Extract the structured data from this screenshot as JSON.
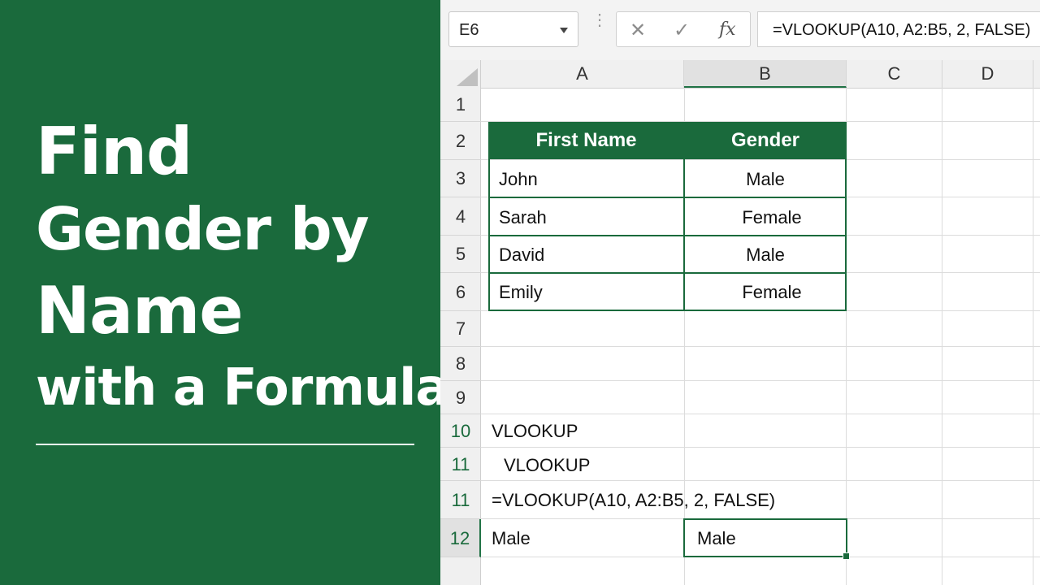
{
  "headline": {
    "line1": "Find",
    "line2": "Gender by",
    "line3": "Name",
    "line4": "with a Formula"
  },
  "formula_bar": {
    "name_box": "E6",
    "cancel_icon": "✕",
    "enter_icon": "✓",
    "fx_label": "fx",
    "formula": "=VLOOKUP(A10, A2:B5, 2, FALSE)"
  },
  "columns": [
    "A",
    "B",
    "C",
    "D"
  ],
  "rows": [
    "1",
    "2",
    "3",
    "4",
    "5",
    "6",
    "7",
    "8",
    "9",
    "10",
    "11",
    "11",
    "12"
  ],
  "table": {
    "headers": [
      "First Name",
      "Gender"
    ],
    "data": [
      [
        "John",
        "Male"
      ],
      [
        "Sarah",
        "Female"
      ],
      [
        "David",
        "Male"
      ],
      [
        "Emily",
        "Female"
      ]
    ]
  },
  "cells": {
    "a10": "VLOOKUP",
    "a11": "VLOOKUP",
    "a11b": "=VLOOKUP(A10, A2:B5, 2, FALSE)",
    "a12": "Male",
    "b12": "Male"
  },
  "colors": {
    "brand_green": "#1a6a3c",
    "header_bg": "#f0f0f0"
  }
}
